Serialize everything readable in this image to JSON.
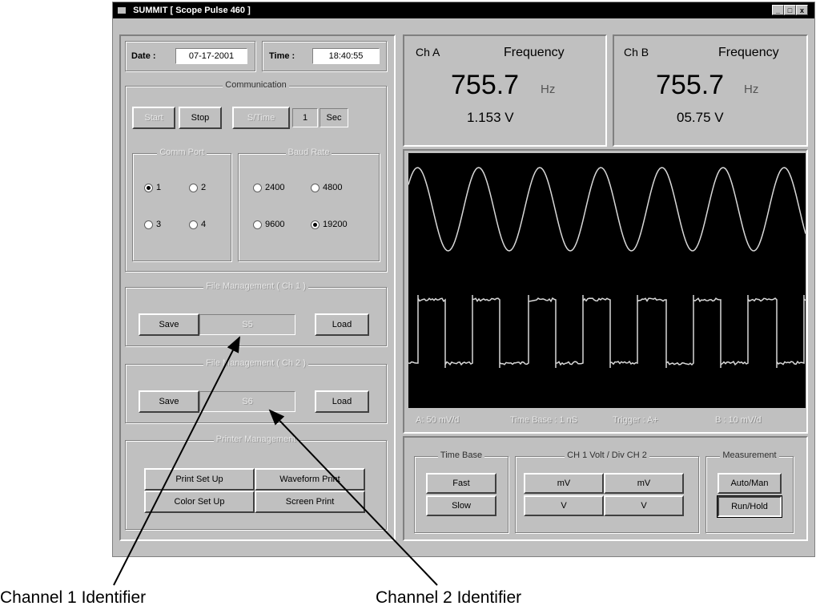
{
  "window": {
    "title": "SUMMIT  [ Scope Pulse 460 ]",
    "controls": [
      "_",
      "□",
      "x"
    ]
  },
  "datetime": {
    "date_label": "Date :",
    "date_value": "07-17-2001",
    "time_label": "Time :",
    "time_value": "18:40:55"
  },
  "communication": {
    "title": "Communication",
    "start": "Start",
    "stop": "Stop",
    "set_time": "S/Time",
    "interval": "1",
    "unit": "Sec",
    "comm_port": {
      "title": "Comm Port",
      "options": [
        "1",
        "2",
        "3",
        "4"
      ],
      "selected": "1"
    },
    "baud_rate": {
      "title": "Baud Rate",
      "options": [
        "2400",
        "4800",
        "9600",
        "19200"
      ],
      "selected": "19200"
    }
  },
  "file_ch1": {
    "title": "File Management ( Ch 1 )",
    "save": "Save",
    "id": "S5",
    "load": "Load"
  },
  "file_ch2": {
    "title": "File Management ( Ch 2 )",
    "save": "Save",
    "id": "S6",
    "load": "Load"
  },
  "printer": {
    "title": "Printer Management",
    "print_setup": "Print Set Up",
    "waveform_print": "Waveform Print",
    "color_setup": "Color Set Up",
    "screen_print": "Screen Print"
  },
  "channel_a": {
    "label": "Ch A",
    "freq_label": "Frequency",
    "freq_value": "755.7",
    "freq_unit": "Hz",
    "voltage": "1.153 V"
  },
  "channel_b": {
    "label": "Ch B",
    "freq_label": "Frequency",
    "freq_value": "755.7",
    "freq_unit": "Hz",
    "voltage": "05.75 V"
  },
  "scope": {
    "background": "#000000",
    "trace_color": "#d8d8d8",
    "sine_cycles": 6.5,
    "square_cycles": 7.2
  },
  "status": {
    "a": "A:  50 mV/d",
    "time_base": "Time Base :  1 nS",
    "trigger": "Trigger :  A+",
    "b": "B :  10 mV/d"
  },
  "controls": {
    "time_base": {
      "title": "Time Base",
      "fast": "Fast",
      "slow": "Slow"
    },
    "volt_div": {
      "title": "CH 1  Volt / Div  CH 2",
      "ch1_mv": "mV",
      "ch2_mv": "mV",
      "ch1_v": "V",
      "ch2_v": "V"
    },
    "measurement": {
      "title": "Measurement",
      "auto_man": "Auto/Man",
      "run_hold": "Run/Hold"
    }
  },
  "annotations": {
    "channel1": "Channel 1 Identifier",
    "channel2": "Channel 2 Identifier"
  }
}
